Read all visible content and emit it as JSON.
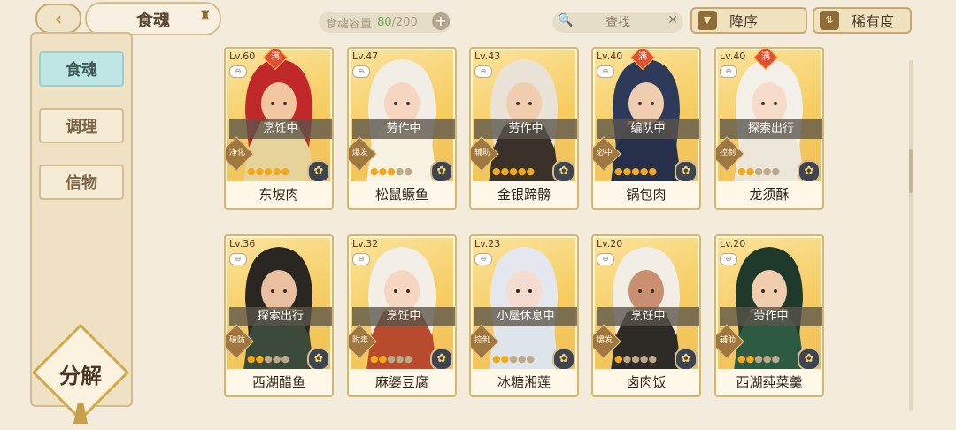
{
  "header": {
    "back_icon": "back-arrow-icon",
    "title": "食魂",
    "capacity_label": "食魂容量",
    "capacity_current": "80",
    "capacity_max": "/200",
    "capacity_plus": "+",
    "search_placeholder": "查找",
    "search_icon": "🔍",
    "clear_icon": "✕",
    "sort_desc_label": "降序",
    "sort_desc_icon": "▼",
    "sort_rarity_label": "稀有度",
    "sort_rarity_icon": "⇅"
  },
  "sidebar": {
    "items": [
      {
        "label": "食魂",
        "active": true
      },
      {
        "label": "调理",
        "active": false
      },
      {
        "label": "信物",
        "active": false
      }
    ],
    "decompose_label": "分解"
  },
  "cards": [
    {
      "level": "Lv.60",
      "full": true,
      "status": "烹饪中",
      "tag": "净化",
      "stars": 5,
      "name": "东坡肉",
      "hair": "#c0282a",
      "skin": "#f1c6a0",
      "cloth": "#e6d39a"
    },
    {
      "level": "Lv.47",
      "full": false,
      "status": "劳作中",
      "tag": "爆发",
      "stars": 3,
      "name": "松鼠鳜鱼",
      "hair": "#f2eee6",
      "skin": "#f6d6c0",
      "cloth": "#f8f2e2"
    },
    {
      "level": "Lv.43",
      "full": false,
      "status": "劳作中",
      "tag": "辅助",
      "stars": 5,
      "name": "金银蹄髈",
      "hair": "#e9e2d6",
      "skin": "#f1cdb0",
      "cloth": "#3a3228"
    },
    {
      "level": "Lv.40",
      "full": true,
      "status": "编队中",
      "tag": "必中",
      "stars": 5,
      "name": "锅包肉",
      "hair": "#2d3a5a",
      "skin": "#f1cdb0",
      "cloth": "#26304a"
    },
    {
      "level": "Lv.40",
      "full": true,
      "status": "探索出行",
      "tag": "控制",
      "stars": 2,
      "name": "龙须酥",
      "hair": "#f3f0ea",
      "skin": "#f6dcc8",
      "cloth": "#ece6d8"
    },
    {
      "level": "Lv.36",
      "full": false,
      "status": "探索出行",
      "tag": "破防",
      "stars": 2,
      "name": "西湖醋鱼",
      "hair": "#2a2622",
      "skin": "#e8c0a0",
      "cloth": "#3b4a3a"
    },
    {
      "level": "Lv.32",
      "full": false,
      "status": "烹饪中",
      "tag": "附毒",
      "stars": 2,
      "name": "麻婆豆腐",
      "hair": "#f3efe6",
      "skin": "#f6d6c0",
      "cloth": "#b84a2e"
    },
    {
      "level": "Lv.23",
      "full": false,
      "status": "小屋休息中",
      "tag": "控制",
      "stars": 2,
      "name": "冰糖湘莲",
      "hair": "#e4e8ee",
      "skin": "#f4dcd0",
      "cloth": "#dde4ea"
    },
    {
      "level": "Lv.20",
      "full": false,
      "status": "烹饪中",
      "tag": "爆发",
      "stars": 1,
      "name": "卤肉饭",
      "hair": "#f2eee6",
      "skin": "#c89070",
      "cloth": "#2e2a26"
    },
    {
      "level": "Lv.20",
      "full": false,
      "status": "劳作中",
      "tag": "辅助",
      "stars": 2,
      "name": "西湖莼菜羹",
      "hair": "#1f3a2a",
      "skin": "#f1cdb0",
      "cloth": "#2f5a42"
    }
  ],
  "labels": {
    "full_badge": "满",
    "lock_icon": "⊖",
    "rarity_icon": "✿",
    "star_on": "☘",
    "star_off": "☘"
  }
}
